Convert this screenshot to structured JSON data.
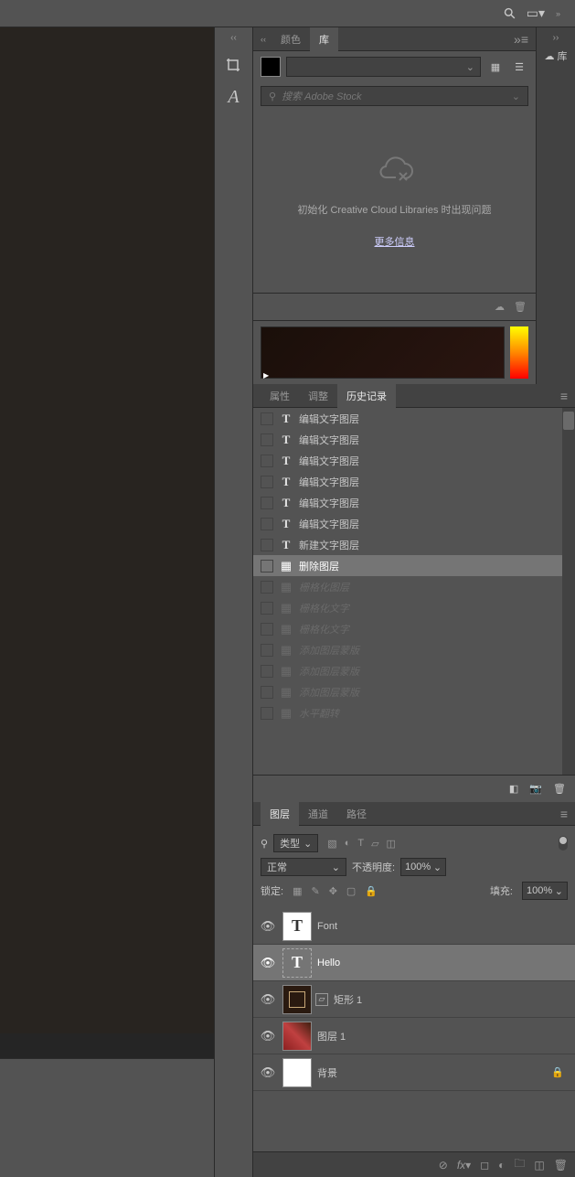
{
  "topbar": {
    "search_icon": "⚲",
    "workspace_icon": "▭"
  },
  "tools": {
    "crop": "✂",
    "type": "A"
  },
  "cc_strip": {
    "label": "库"
  },
  "color_panel": {
    "tab": "颜色"
  },
  "library_panel": {
    "tab": "库",
    "search_placeholder": "搜索 Adobe Stock",
    "error_msg": "初始化 Creative Cloud Libraries 时出现问题",
    "more_info": "更多信息"
  },
  "history_panel": {
    "tabs": {
      "properties": "属性",
      "adjust": "调整",
      "history": "历史记录"
    },
    "items": [
      {
        "icon": "T",
        "label": "编辑文字图层",
        "type": "type"
      },
      {
        "icon": "T",
        "label": "编辑文字图层",
        "type": "type"
      },
      {
        "icon": "T",
        "label": "编辑文字图层",
        "type": "type"
      },
      {
        "icon": "T",
        "label": "编辑文字图层",
        "type": "type"
      },
      {
        "icon": "T",
        "label": "编辑文字图层",
        "type": "type"
      },
      {
        "icon": "T",
        "label": "编辑文字图层",
        "type": "type"
      },
      {
        "icon": "T",
        "label": "新建文字图层",
        "type": "type"
      },
      {
        "icon": "▦",
        "label": "删除图层",
        "type": "sel"
      },
      {
        "icon": "▦",
        "label": "栅格化图层",
        "type": "dis"
      },
      {
        "icon": "▦",
        "label": "栅格化文字",
        "type": "dis"
      },
      {
        "icon": "▦",
        "label": "栅格化文字",
        "type": "dis"
      },
      {
        "icon": "▦",
        "label": "添加图层蒙版",
        "type": "dis"
      },
      {
        "icon": "▦",
        "label": "添加图层蒙版",
        "type": "dis"
      },
      {
        "icon": "▦",
        "label": "添加图层蒙版",
        "type": "dis"
      },
      {
        "icon": "▦",
        "label": "水平翻转",
        "type": "dis"
      }
    ]
  },
  "layers_panel": {
    "tabs": {
      "layers": "图层",
      "channels": "通道",
      "paths": "路径"
    },
    "filter_label": "类型",
    "blend_mode": "正常",
    "opacity_label": "不透明度:",
    "opacity_value": "100%",
    "lock_label": "锁定:",
    "fill_label": "填充:",
    "fill_value": "100%",
    "layers": [
      {
        "name": "Font",
        "thumb": "T",
        "kind": "type",
        "visible": true
      },
      {
        "name": "Hello",
        "thumb": "T",
        "kind": "type-sel",
        "visible": true,
        "selected": true
      },
      {
        "name": "矩形 1",
        "thumb": "",
        "kind": "shape",
        "visible": true
      },
      {
        "name": "图层 1",
        "thumb": "",
        "kind": "image",
        "visible": true
      },
      {
        "name": "背景",
        "thumb": "",
        "kind": "bg",
        "visible": true,
        "locked": true
      }
    ]
  }
}
